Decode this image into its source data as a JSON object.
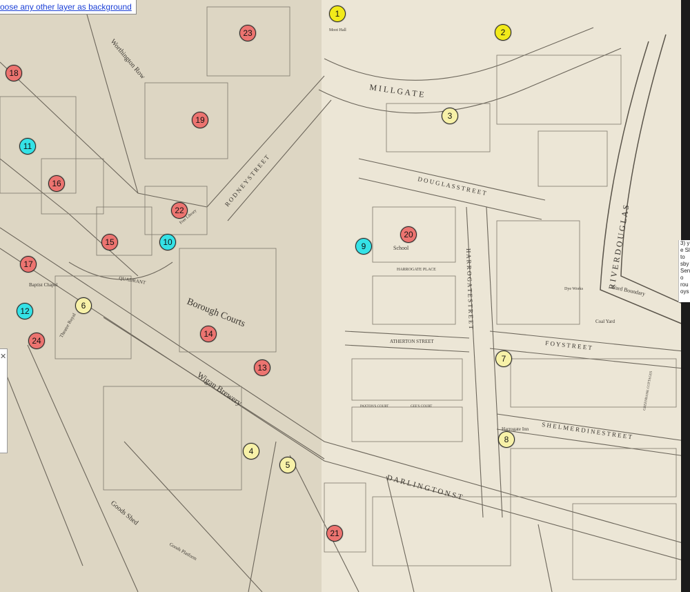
{
  "layer_link": "oose any other layer as background",
  "colors": {
    "red": "#ec7470",
    "cyan": "#35e2e6",
    "cream": "#f7f1a8",
    "yellow": "#f2ea1a"
  },
  "map_labels": {
    "millgate": "M I L L G A T E",
    "douglas_street": "D O U G L A S   S T R E E T",
    "river_douglas": "R I V E R   D O U G L A S",
    "harrogate_street": "H A R R O G A T E   S T R E E T",
    "foy_street": "F O Y   S T R E E T",
    "shelmerdine_street": "S H E L M E R D I N E   S T R E E T",
    "darlington_street": "D A R L I N G T O N   S T",
    "atherton_street": "ATHERTON STREET",
    "harrogate_place": "HARROGATE PLACE",
    "borough_courts": "Borough Courts",
    "wigan_brewery": "Wigan Brewery",
    "rodney_street": "R O D N E Y   S T R E E T",
    "worthington_row": "Worthington Row",
    "goods_platform": "Goods Platform",
    "goods_shed": "Goods Shed",
    "ward_boundary": "Ward Boundary",
    "coal_yard": "Coal Yard",
    "school": "School",
    "theatre_royal": "Theatre Royal",
    "baptist_chapel": "Baptist Chapel",
    "harrogate_inn": "Harrogate Inn",
    "free_library": "Free Library",
    "dye_works": "Dye Works",
    "greenbank_cottages": "GREENBANK COTTAGES",
    "gees_court": "GEE'S COURT",
    "paxtons_court": "PAXTON'S COURT",
    "quadrant": "QUADRANT",
    "moot_hall": "Moot Hall"
  },
  "markers": [
    {
      "label": "1",
      "color": "yellow"
    },
    {
      "label": "2",
      "color": "yellow"
    },
    {
      "label": "3",
      "color": "cream"
    },
    {
      "label": "4",
      "color": "cream"
    },
    {
      "label": "5",
      "color": "cream"
    },
    {
      "label": "6",
      "color": "cream"
    },
    {
      "label": "7",
      "color": "cream"
    },
    {
      "label": "8",
      "color": "cream"
    },
    {
      "label": "9",
      "color": "cyan"
    },
    {
      "label": "10",
      "color": "cyan"
    },
    {
      "label": "11",
      "color": "cyan"
    },
    {
      "label": "12",
      "color": "cyan"
    },
    {
      "label": "13",
      "color": "red"
    },
    {
      "label": "14",
      "color": "red"
    },
    {
      "label": "15",
      "color": "red"
    },
    {
      "label": "16",
      "color": "red"
    },
    {
      "label": "17",
      "color": "red"
    },
    {
      "label": "18",
      "color": "red"
    },
    {
      "label": "19",
      "color": "red"
    },
    {
      "label": "20",
      "color": "red"
    },
    {
      "label": "21",
      "color": "red"
    },
    {
      "label": "22",
      "color": "red"
    },
    {
      "label": "23",
      "color": "red"
    },
    {
      "label": "24",
      "color": "red"
    }
  ],
  "side_text": [
    "3) y",
    "e Sl",
    "to",
    "sby",
    "Sen",
    "o",
    "rou",
    "oys"
  ]
}
